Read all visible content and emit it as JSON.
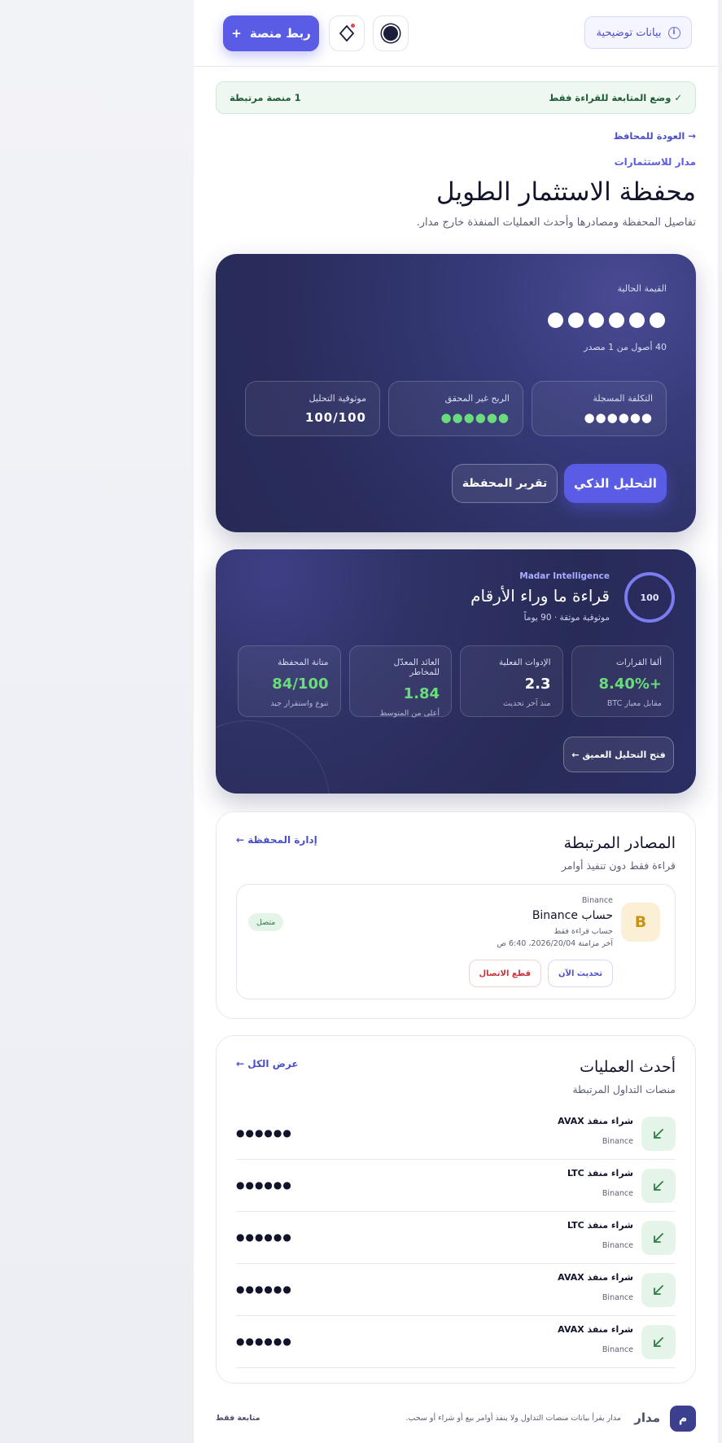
{
  "header": {
    "demo_label": "بيانات توضيحية",
    "link_platform_label": "ربط منصة",
    "plus_glyph": "+"
  },
  "banner": {
    "read_only": "✓ وضع المتابعة للقراءة فقط",
    "linked_count": "1 منصة مرتبطة"
  },
  "nav": {
    "back_link": "→ العودة للمحافظ",
    "brand": "مدار للاستثمارات"
  },
  "page": {
    "title": "محفظة الاستثمار الطويل",
    "subtitle": "تفاصيل المحفظة ومصادرها وأحدث العمليات المنفذة خارج مدار."
  },
  "portfolio": {
    "current_value_label": "القيمة الحالية",
    "assets_text": "40 أصول من 1 مصدر",
    "stats": [
      {
        "label": "التكلفة المسجلة",
        "value": "●●●●●●"
      },
      {
        "label": "الربح غير المحقق",
        "value": "●●●●●●"
      },
      {
        "label": "موثوقية التحليل",
        "value": "100/100"
      }
    ],
    "ai_button": "التحليل الذكي",
    "report_button": "تقرير المحفظة"
  },
  "intelligence": {
    "score": "100",
    "brand": "Madar Intelligence",
    "title": "قراءة ما وراء الأرقام",
    "subtitle": "موثوقية موثقة · 90 يوماً",
    "metrics": [
      {
        "label": "ألفا القرارات",
        "value": "+8.40%",
        "note": "مقابل معيار BTC"
      },
      {
        "label": "الإدوات الفعلية",
        "value": "2.3",
        "note": "منذ آخر تحديث"
      },
      {
        "label": "العائد المعدّل للمخاطر",
        "value": "1.84",
        "note": "أعلى من المتوسط"
      },
      {
        "label": "متانة المحفظة",
        "value": "84/100",
        "note": "تنوع واستقرار جيد"
      }
    ],
    "deep_button": "فتح التحليل العميق ←"
  },
  "sources": {
    "title": "المصادر المرتبطة",
    "subtitle": "قراءة فقط دون تنفيذ أوامر",
    "manage_link": "إدارة المحفظة ←",
    "item": {
      "logo_letter": "B",
      "tag": "Binance",
      "name": "حساب Binance",
      "mode": "حساب قراءة فقط",
      "last_sync": "آخر مزامنة 2026/20/04، 6:40 ص",
      "status": "متصل",
      "sync_button": "تحديث الآن",
      "disconnect_button": "قطع الاتصال"
    }
  },
  "transactions": {
    "title": "أحدث العمليات",
    "subtitle": "منصات التداول المرتبطة",
    "view_all": "عرض الكل ←",
    "rows": [
      {
        "name": "شراء منفذ AVAX",
        "exchange": "Binance",
        "amount": "●●●●●●"
      },
      {
        "name": "شراء منفذ LTC",
        "exchange": "Binance",
        "amount": "●●●●●●"
      },
      {
        "name": "شراء منفذ LTC",
        "exchange": "Binance",
        "amount": "●●●●●●"
      },
      {
        "name": "شراء منفذ AVAX",
        "exchange": "Binance",
        "amount": "●●●●●●"
      },
      {
        "name": "شراء منفذ AVAX",
        "exchange": "Binance",
        "amount": "●●●●●●"
      }
    ]
  },
  "footer": {
    "logo_letter": "م",
    "brand": "مدار",
    "note": "مدار يقرأ بيانات منصات التداول ولا ينفذ أوامر بيع أو شراء أو سحب.",
    "follow": "متابعة فقط"
  },
  "colors": {
    "accent": "#5b5ce6",
    "hero_bg": "#2a2d5d",
    "positive": "#6bdc7c",
    "danger": "#c8323a"
  }
}
